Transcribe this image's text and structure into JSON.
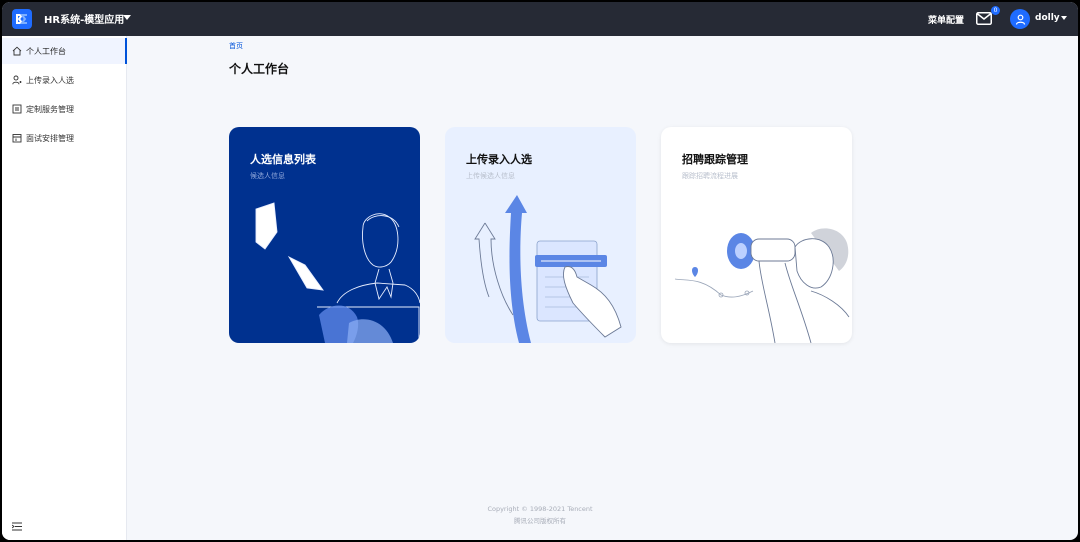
{
  "header": {
    "app_title": "HR系统-模型应用",
    "menu_config": "菜单配置",
    "mail_badge": "0",
    "username": "dolly"
  },
  "sidebar": {
    "items": [
      {
        "label": "个人工作台",
        "icon": "home-icon",
        "active": true
      },
      {
        "label": "上传录入人选",
        "icon": "user-icon",
        "active": false
      },
      {
        "label": "定制服务管理",
        "icon": "document-icon",
        "active": false
      },
      {
        "label": "面试安排管理",
        "icon": "calendar-icon",
        "active": false
      }
    ]
  },
  "main": {
    "breadcrumb": "首页",
    "title": "个人工作台",
    "cards": [
      {
        "title": "人选信息列表",
        "subtitle": "候选人信息"
      },
      {
        "title": "上传录入人选",
        "subtitle": "上传候选人信息"
      },
      {
        "title": "招聘跟踪管理",
        "subtitle": "跟踪招聘流程进展"
      }
    ]
  },
  "footer": {
    "copyright": "Copyright © 1998-2021 Tencent",
    "rights": "腾讯公司版权所有"
  },
  "colors": {
    "accent": "#0052d9",
    "topbar": "#262a35",
    "card_dark": "#00318f"
  }
}
